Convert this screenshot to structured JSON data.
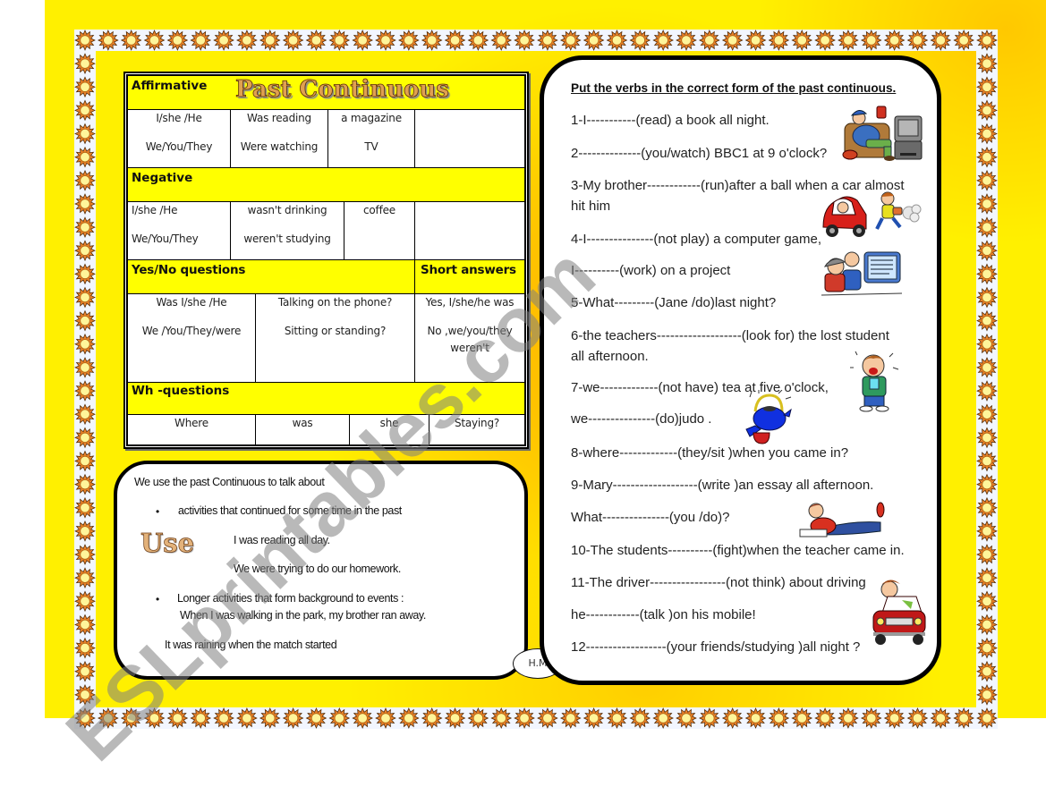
{
  "table": {
    "title": "Past Continuous",
    "affirmative": {
      "label": "Affirmative",
      "cells": [
        [
          "I/she /He",
          "We/You/They"
        ],
        [
          "Was reading",
          "Were watching"
        ],
        [
          "a magazine",
          "TV"
        ],
        []
      ]
    },
    "negative": {
      "label": "Negative",
      "cells": [
        [
          "I/she /He",
          "We/You/They"
        ],
        [
          "wasn't drinking",
          "weren't  studying"
        ],
        [
          "coffee"
        ],
        []
      ]
    },
    "yes_no": {
      "label": "Yes/No questions",
      "short_answers_label": "Short answers",
      "cells": [
        [
          "Was  I/she /He",
          "We /You/They/were"
        ],
        [
          "Talking on the phone?",
          "Sitting or standing?"
        ],
        [
          "Yes, I/she/he was",
          "No ,we/you/they weren't"
        ]
      ]
    },
    "wh": {
      "label": "Wh -questions",
      "cells": [
        "Where",
        "was",
        "she",
        "Staying?"
      ]
    }
  },
  "usage": {
    "intro": "We use the past Continuous to talk about",
    "heading": "Use",
    "bullet_symbol": "•",
    "bullets": [
      {
        "text": "activities that continued for some time in the past",
        "examples": [
          "I was reading all day.",
          "We were trying to do our homework."
        ]
      },
      {
        "text": "Longer activities that form background to events :",
        "examples": [
          "When I was walking in the park, my brother ran away."
        ]
      }
    ],
    "extra_example": "It was raining when the match started"
  },
  "signature": "H.M",
  "exercise": {
    "instruction": "Put the verbs in the correct form of the past continuous.",
    "lines": [
      "1-I-----------(read) a book all night.",
      "2--------------(you/watch) BBC1 at 9 o'clock?",
      "3-My brother------------(run)after a ball when a car almost",
      "hit him",
      "4-I---------------(not play) a computer game,",
      "I----------(work) on a project",
      "5-What---------(Jane /do)last night?",
      "6-the teachers-------------------(look for) the lost student",
      "all afternoon.",
      "7-we-------------(not have) tea at five o'clock,",
      "we---------------(do)judo .",
      "8-where-------------(they/sit )when you came in?",
      "9-Mary-------------------(write )an essay all afternoon.",
      "What---------------(you /do)?",
      "10-The students----------(fight)when the teacher came in.",
      "11-The driver-----------------(not think) about driving",
      "he------------(talk )on his mobile!",
      "12------------------(your friends/studying )all night ?"
    ]
  },
  "watermark": "ESLprintables.com",
  "colors": {
    "page_yellow": "#FFF000",
    "page_orange": "#FFB400",
    "header_yellow": "#FFFF00",
    "sun_orange": "#E8822A",
    "sun_center": "#FFF59A",
    "title_gold": "#E0A050"
  }
}
